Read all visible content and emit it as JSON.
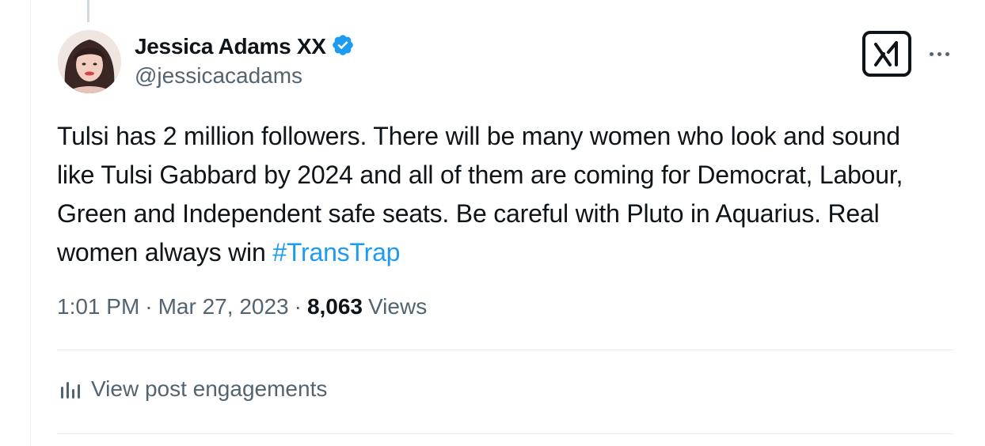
{
  "author": {
    "display_name": "Jessica Adams XX",
    "handle": "@jessicacadams",
    "verified": true
  },
  "tweet": {
    "text_before_hashtag": "Tulsi has 2 million followers. There will be many women who look and sound like Tulsi Gabbard by 2024 and all of them are coming for Democrat, Labour, Green and Independent safe seats. Be careful with Pluto in Aquarius.  Real women always win ",
    "hashtag": "#TransTrap"
  },
  "meta": {
    "time": "1:01 PM",
    "separator": "·",
    "date": "Mar 27, 2023",
    "views_count": "8,063",
    "views_label": "Views"
  },
  "engagements": {
    "label": "View post engagements"
  },
  "icons": {
    "verified": "verified-badge-icon",
    "grok": "grok-icon",
    "more": "more-dots-icon",
    "analytics": "analytics-icon"
  },
  "colors": {
    "accent": "#1d9bf0",
    "text_primary": "#0f1419",
    "text_secondary": "#536471",
    "divider": "#e6ecf0"
  }
}
